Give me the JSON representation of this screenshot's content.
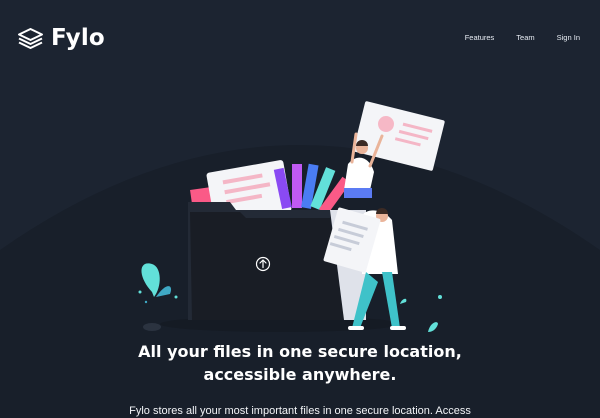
{
  "brand": {
    "name": "Fylo",
    "logo_icon": "stacked-layers-icon"
  },
  "nav": {
    "items": [
      {
        "label": "Features"
      },
      {
        "label": "Team"
      },
      {
        "label": "Sign In"
      }
    ]
  },
  "hero": {
    "title_line1": "All your files in one secure location,",
    "title_line2": "accessible anywhere.",
    "intro": "Fylo stores all your most important files in one secure location. Access",
    "upload_icon": "upload-arrow-icon"
  },
  "colors": {
    "background": "#1c2431",
    "folder": "#1a1e26",
    "accent_teal": "#62e0d9",
    "accent_pink": "#fa5a87",
    "text": "#ffffff"
  }
}
